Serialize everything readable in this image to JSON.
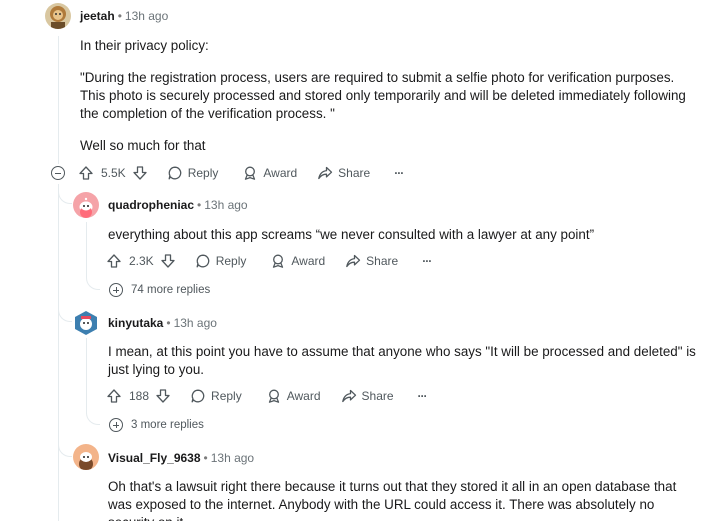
{
  "comments": [
    {
      "author": "jeetah",
      "time": "13h ago",
      "paragraphs": [
        "In their privacy policy:",
        "\"During the registration process, users are required to submit a selfie photo for verification purposes. This photo is securely processed and stored only temporarily and will be deleted immediately following the completion of the verification process. \"",
        "Well so much for that"
      ],
      "votes": "5.5K",
      "reply": "Reply",
      "award": "Award",
      "share": "Share",
      "more": "···"
    },
    {
      "author": "quadropheniac",
      "time": "13h ago",
      "paragraphs": [
        "everything about this app screams “we never consulted with a lawyer at any point”"
      ],
      "votes": "2.3K",
      "reply": "Reply",
      "award": "Award",
      "share": "Share",
      "more": "···",
      "more_replies": "74 more replies"
    },
    {
      "author": "kinyutaka",
      "time": "13h ago",
      "paragraphs": [
        "I mean, at this point you have to assume that anyone who says \"It will be processed and deleted\" is just lying to you."
      ],
      "votes": "188",
      "reply": "Reply",
      "award": "Award",
      "share": "Share",
      "more": "···",
      "more_replies": "3 more replies"
    },
    {
      "author": "Visual_Fly_9638",
      "time": "13h ago",
      "paragraphs": [
        "Oh that's a lawsuit right there because it turns out that they stored it all in an open database that was exposed to the internet. Anybody with the URL could access it. There was absolutely no security on it."
      ]
    }
  ],
  "separator": "•",
  "colors": {
    "thread_line": "#e5ebee",
    "avatar_1": "#c9a46a",
    "avatar_2": "#f5a3a8",
    "avatar_3": "#3d7fb0",
    "avatar_4": "#f3b48a"
  }
}
